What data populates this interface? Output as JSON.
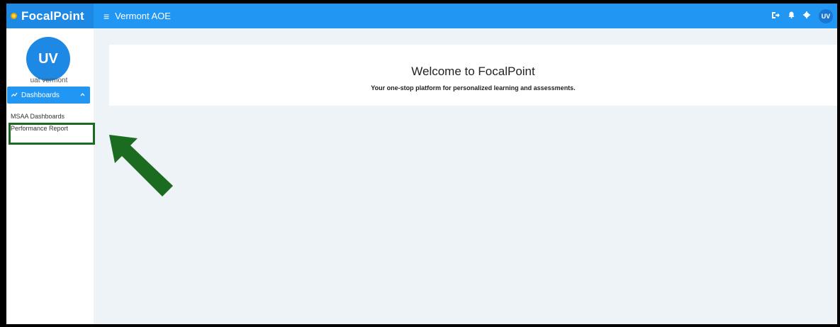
{
  "app": {
    "name": "FocalPoint",
    "org": "Vermont AOE"
  },
  "header": {
    "menu_icon": "≡",
    "actions": {
      "logout_icon": "logout-icon",
      "bell_icon": "bell-icon",
      "gear_icon": "gear-icon",
      "avatar_initials": "UV"
    }
  },
  "sidebar": {
    "avatar_initials": "UV",
    "user_name": "uat vermont",
    "group": {
      "label": "Dashboards",
      "icon": "trending-up-icon"
    },
    "items": [
      {
        "label": "MSAA Dashboards"
      },
      {
        "label": "Performance Report"
      }
    ]
  },
  "main": {
    "title": "Welcome to FocalPoint",
    "subtitle": "Your one-stop platform for personalized learning and assessments."
  },
  "annotation": {
    "color": "#1b6b21"
  },
  "colors": {
    "primary": "#2196f3",
    "background": "#edf3f7"
  }
}
